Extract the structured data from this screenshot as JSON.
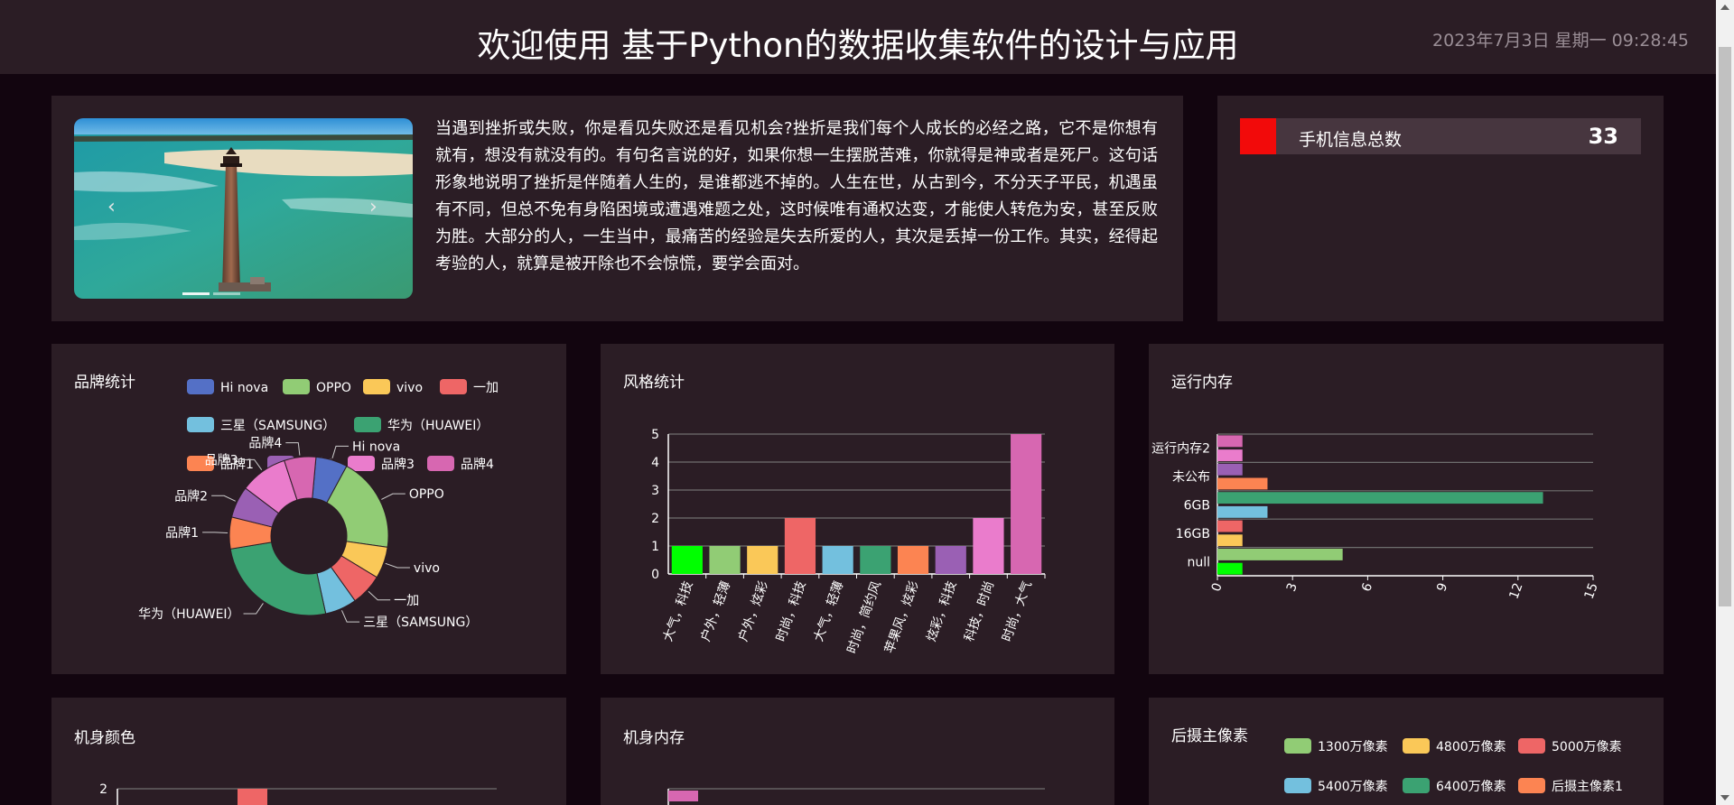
{
  "header": {
    "title": "欢迎使用 基于Python的数据收集软件的设计与应用",
    "datetime": "2023年7月3日 星期一 09:28:45"
  },
  "intro": {
    "carousel": {
      "prev_icon": "chevron-left-icon",
      "next_icon": "chevron-right-icon",
      "prev_glyph": "‹",
      "next_glyph": "›"
    },
    "text": "当遇到挫折或失败，你是看见失败还是看见机会?挫折是我们每个人成长的必经之路，它不是你想有就有，想没有就没有的。有句名言说的好，如果你想一生摆脱苦难，你就得是神或者是死尸。这句话形象地说明了挫折是伴随着人生的，是谁都逃不掉的。人生在世，从古到今，不分天子平民，机遇虽有不同，但总不免有身陷困境或遭遇难题之处，这时候唯有通权达变，才能使人转危为安，甚至反败为胜。大部分的人，一生当中，最痛苦的经验是失去所爱的人，其次是丢掉一份工作。其实，经得起考验的人，就算是被开除也不会惊慌，要学会面对。"
  },
  "stats": {
    "label": "手机信息总数",
    "value": "33",
    "accent": "#f20a0a"
  },
  "panels": {
    "brand": "品牌统计",
    "style": "风格统计",
    "ram": "运行内存",
    "color": "机身颜色",
    "rom": "机身内存",
    "camera": "后摄主像素"
  },
  "chart_data": [
    {
      "type": "pie",
      "title": "品牌统计",
      "legend_position": "top",
      "categories": [
        "Hi nova",
        "OPPO",
        "vivo",
        "一加",
        "三星（SAMSUNG）",
        "华为（HUAWEI）",
        "品牌1",
        "品牌2",
        "品牌3",
        "品牌4"
      ],
      "values": [
        2,
        6,
        2,
        2,
        2,
        8,
        2,
        2,
        3,
        2
      ],
      "colors": [
        "#5470c6",
        "#91cc75",
        "#fac858",
        "#ee6666",
        "#73c0de",
        "#3ba272",
        "#fc8452",
        "#9a60b4",
        "#ea7ccc",
        "#d767b1"
      ],
      "donut": true
    },
    {
      "type": "bar",
      "title": "风格统计",
      "categories": [
        "大气，科技",
        "户外，轻薄",
        "户外，炫彩",
        "时尚，科技",
        "大气，轻薄",
        "时尚，简约风",
        "苹果风，炫彩",
        "炫彩，科技",
        "科技，时尚",
        "时尚，大气"
      ],
      "values": [
        1,
        1,
        1,
        2,
        1,
        1,
        1,
        1,
        2,
        5
      ],
      "colors": [
        "#00ff00",
        "#91cc75",
        "#fac858",
        "#ee6666",
        "#73c0de",
        "#3ba272",
        "#fc8452",
        "#9a60b4",
        "#ea7ccc",
        "#d767b1"
      ],
      "ylim": [
        0,
        5
      ],
      "yticks": [
        "0",
        "1",
        "2",
        "3",
        "4",
        "5"
      ],
      "grid": true
    },
    {
      "type": "bar",
      "title": "运行内存",
      "orientation": "horizontal",
      "visible_category_labels": [
        "null",
        "16GB",
        "6GB",
        "未公布",
        "运行内存2"
      ],
      "values": [
        1,
        5,
        1,
        1,
        2,
        13,
        2,
        1,
        1,
        1
      ],
      "colors": [
        "#00ff00",
        "#91cc75",
        "#fac858",
        "#ee6666",
        "#73c0de",
        "#3ba272",
        "#fc8452",
        "#9a60b4",
        "#ea7ccc",
        "#d767b1"
      ],
      "xlim": [
        0,
        15
      ],
      "xticks": [
        "0",
        "3",
        "6",
        "9",
        "12",
        "15"
      ],
      "grid": true
    },
    {
      "type": "bar",
      "title": "机身颜色",
      "yticks": [
        "2"
      ],
      "visible_bar_color": "#ee6666"
    },
    {
      "type": "bar",
      "title": "机身内存",
      "orientation": "horizontal",
      "visible_bar_color": "#d767b1"
    },
    {
      "type": "pie",
      "title": "后摄主像素",
      "legend_position": "top",
      "categories": [
        "1300万像素",
        "4800万像素",
        "5000万像素",
        "5400万像素",
        "6400万像素",
        "后摄主像素1"
      ],
      "colors": [
        "#91cc75",
        "#fac858",
        "#ee6666",
        "#73c0de",
        "#3ba272",
        "#fc8452"
      ]
    }
  ]
}
